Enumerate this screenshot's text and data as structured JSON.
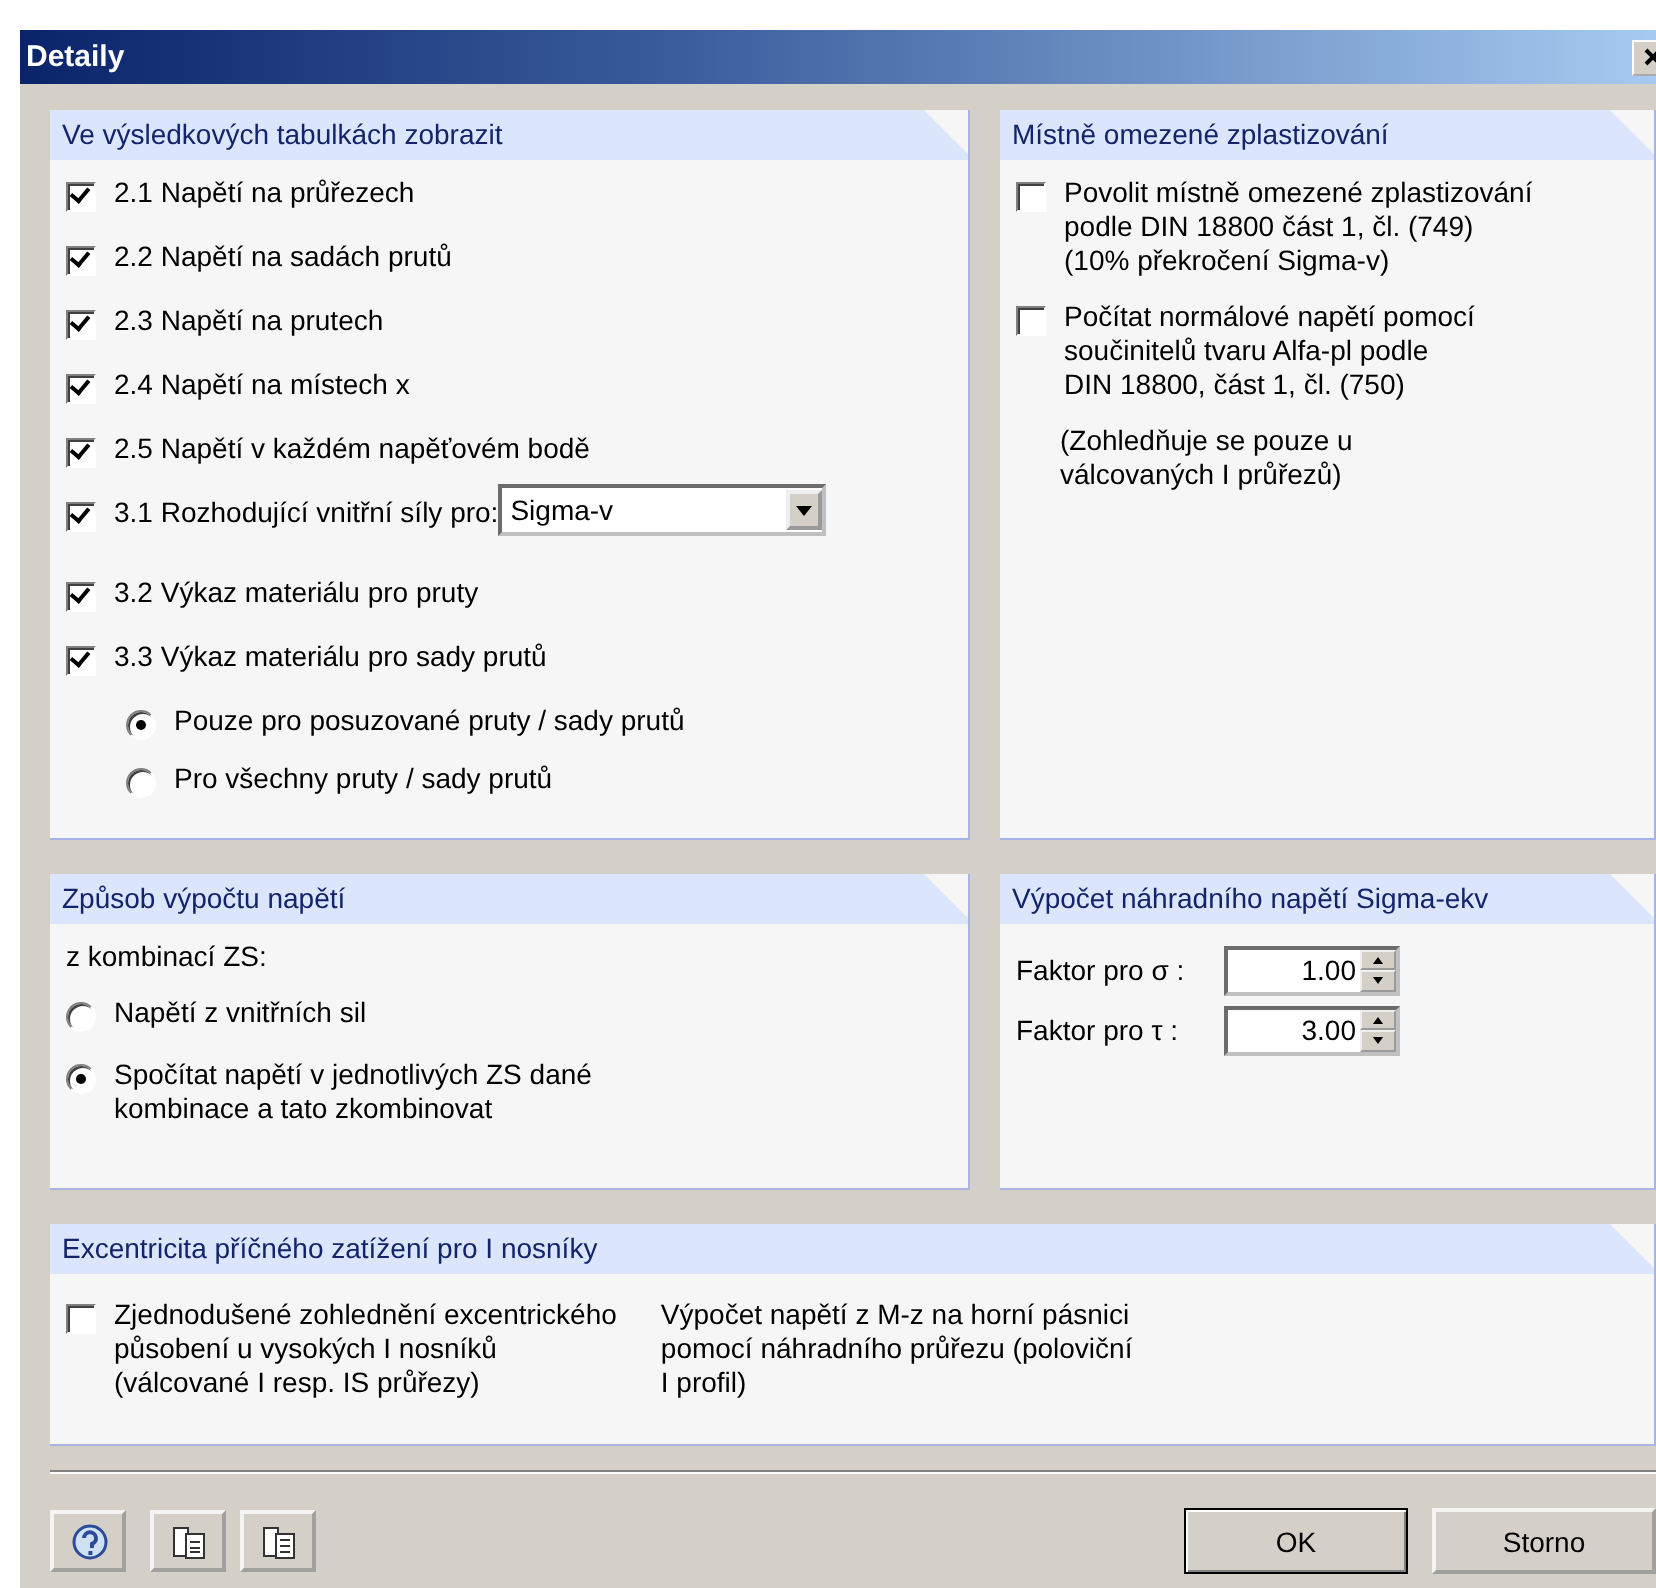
{
  "window": {
    "title": "Detaily"
  },
  "display_panel": {
    "title": "Ve výsledkových tabulkách zobrazit",
    "items": [
      {
        "kind": "checkbox",
        "label": "2.1 Napětí na průřezech",
        "checked": true
      },
      {
        "kind": "checkbox",
        "label": "2.2 Napětí na sadách prutů",
        "checked": true
      },
      {
        "kind": "checkbox",
        "label": "2.3 Napětí na prutech",
        "checked": true
      },
      {
        "kind": "checkbox",
        "label": "2.4 Napětí na místech x",
        "checked": true
      },
      {
        "kind": "checkbox",
        "label": "2.5 Napětí v každém napěťovém bodě",
        "checked": true
      },
      {
        "kind": "checkbox_select",
        "label": "3.1 Rozhodující vnitřní síly pro:",
        "checked": true,
        "value": "Sigma-v"
      },
      {
        "kind": "checkbox",
        "label": "3.2 Výkaz materiálu pro pruty",
        "checked": true
      },
      {
        "kind": "checkbox",
        "label": "3.3 Výkaz materiálu pro sady prutů",
        "checked": true
      },
      {
        "kind": "radio",
        "label": "Pouze pro posuzované pruty / sady prutů",
        "selected": true
      },
      {
        "kind": "radio",
        "label": "Pro všechny pruty / sady prutů",
        "selected": false
      }
    ]
  },
  "plastic_panel": {
    "title": "Místně omezené zplastizování",
    "items": [
      {
        "kind": "checkbox",
        "label": "Povolit místně omezené zplastizování\npodle DIN 18800 část 1, čl. (749)\n(10% překročení Sigma-v)",
        "checked": false
      },
      {
        "kind": "checkbox",
        "label": "Počítat normálové napětí pomocí\nsoučinitelů tvaru Alfa-pl podle\nDIN 18800, část 1, čl. (750)",
        "checked": false
      },
      {
        "kind": "note",
        "label": "(Zohledňuje se pouze u\nválcovaných I průřezů)"
      }
    ]
  },
  "stress_panel": {
    "title": "Způsob výpočtu napětí",
    "items": [
      {
        "kind": "text",
        "label": "z kombinací ZS:"
      },
      {
        "kind": "radio",
        "label": "Napětí z vnitřních sil",
        "selected": false
      },
      {
        "kind": "radio",
        "label": "Spočítat napětí v jednotlivých ZS dané\nkombinace a tato zkombinovat",
        "selected": true
      }
    ]
  },
  "equivalent_panel": {
    "title": "Výpočet náhradního napětí Sigma-ekv",
    "factors": [
      {
        "label": "Faktor pro σ :",
        "value": "1.00"
      },
      {
        "label": "Faktor pro τ :",
        "value": "3.00"
      }
    ]
  },
  "eccentricity_panel": {
    "title": "Excentricita příčného zatížení pro I nosníky",
    "items": [
      {
        "kind": "checkbox",
        "label": "Zjednodušené zohlednění excentrického\npůsobení u vysokých I nosníků\n(válcované I resp. IS průřezy)",
        "checked": false
      },
      {
        "kind": "note",
        "label": "Výpočet napětí z M-z na horní pásnici\npomocí náhradního průřezu (poloviční\nI profil)"
      }
    ]
  },
  "buttons": [
    "OK",
    "Storno"
  ]
}
